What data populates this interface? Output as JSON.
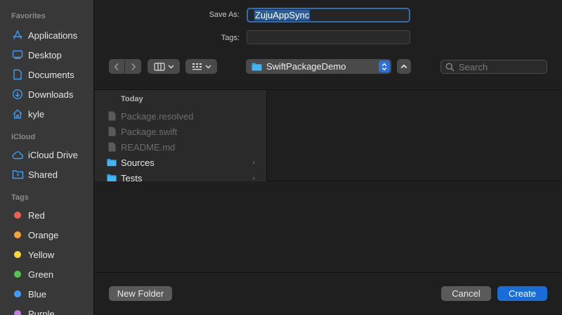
{
  "sidebar": {
    "favorites_header": "Favorites",
    "favorites": [
      {
        "label": "Applications",
        "icon": "applications-icon"
      },
      {
        "label": "Desktop",
        "icon": "desktop-icon"
      },
      {
        "label": "Documents",
        "icon": "document-icon"
      },
      {
        "label": "Downloads",
        "icon": "downloads-icon"
      },
      {
        "label": "kyle",
        "icon": "home-icon"
      }
    ],
    "icloud_header": "iCloud",
    "icloud": [
      {
        "label": "iCloud Drive",
        "icon": "cloud-icon"
      },
      {
        "label": "Shared",
        "icon": "shared-folder-icon"
      }
    ],
    "tags_header": "Tags",
    "tags": [
      {
        "label": "Red",
        "color": "#ec5f57"
      },
      {
        "label": "Orange",
        "color": "#f5a13b"
      },
      {
        "label": "Yellow",
        "color": "#f6d73c"
      },
      {
        "label": "Green",
        "color": "#4fc74f"
      },
      {
        "label": "Blue",
        "color": "#3b9df5"
      },
      {
        "label": "Purple",
        "color": "#c07be0"
      }
    ]
  },
  "form": {
    "save_as_label": "Save As:",
    "save_as_value": "ZujuAppSync",
    "tags_label": "Tags:"
  },
  "toolbar": {
    "location": "SwiftPackageDemo",
    "search_placeholder": "Search"
  },
  "browser": {
    "section_header": "Today",
    "items": [
      {
        "name": "Package.resolved",
        "kind": "file",
        "enabled": false
      },
      {
        "name": "Package.swift",
        "kind": "file",
        "enabled": false
      },
      {
        "name": "README.md",
        "kind": "file",
        "enabled": false
      },
      {
        "name": "Sources",
        "kind": "folder",
        "enabled": true
      },
      {
        "name": "Tests",
        "kind": "folder",
        "enabled": true
      }
    ]
  },
  "footer": {
    "new_folder_label": "New Folder",
    "cancel_label": "Cancel",
    "create_label": "Create"
  },
  "colors": {
    "accent": "#1a6cd8",
    "folder": "#2aa2e8"
  }
}
